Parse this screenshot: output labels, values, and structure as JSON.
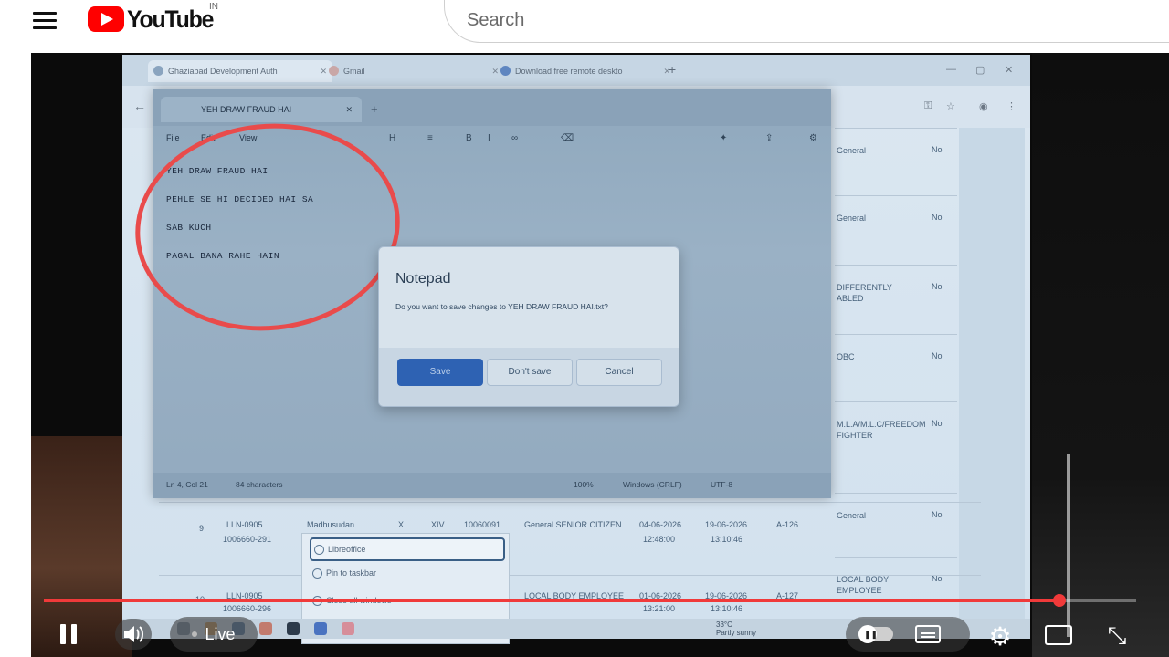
{
  "header": {
    "brand": "YouTube",
    "country": "IN",
    "search_placeholder": "Search"
  },
  "video": {
    "browser": {
      "tabs": [
        {
          "label": "Ghaziabad Development Auth"
        },
        {
          "label": "Gmail"
        },
        {
          "label": "Download free remote deskto"
        }
      ],
      "new_tab": "+"
    },
    "notepad": {
      "tab_title": "YEH DRAW FRAUD HAI",
      "menu": [
        "File",
        "Edit",
        "View"
      ],
      "lines": [
        "YEH DRAW FRAUD HAI",
        "PEHLE SE HI DECIDED HAI SA",
        "SAB KUCH",
        "PAGAL BANA RAHE HAIN"
      ],
      "status": [
        "Ln 4, Col 21",
        "84 characters",
        "100%",
        "Windows (CRLF)",
        "UTF-8"
      ]
    },
    "dialog": {
      "title": "Notepad",
      "message": "Do you want to save changes to YEH DRAW FRAUD HAI.txt?",
      "save": "Save",
      "dont_save": "Don't save",
      "cancel": "Cancel"
    },
    "background_table": {
      "rows": [
        {
          "category": "General",
          "flag": "No"
        },
        {
          "category": "General",
          "flag": "No"
        },
        {
          "category": "DIFFERENTLY ABLED",
          "flag": "No"
        },
        {
          "category": "OBC",
          "flag": "No"
        },
        {
          "category": "M.L.A/M.L.C/FREEDOM FIGHTER",
          "flag": "No"
        },
        {
          "category": "General",
          "flag": "No"
        },
        {
          "category": "LOCAL BODY EMPLOYEE",
          "flag": "No"
        }
      ]
    },
    "bottom_rows": [
      {
        "sno": "9",
        "id": "LLN-0905",
        "reg": "1006660-291",
        "name": "Madhusudan",
        "x1": "X",
        "x2": "XIV",
        "num": "10060091",
        "cat": "General SENIOR CITIZEN",
        "d1": "04-06-2026",
        "t1": "12:48:00",
        "d2": "19-06-2026",
        "t2": "13:10:46",
        "plot": "A-126"
      },
      {
        "sno": "10",
        "id": "LLN-0905",
        "reg": "1006660-296",
        "cat": "LOCAL BODY EMPLOYEE",
        "d1": "01-06-2026",
        "t1": "13:21:00",
        "d2": "19-06-2026",
        "t2": "13:10:46",
        "plot": "A-127"
      }
    ],
    "context_menu": {
      "items": [
        "Libreoffice",
        "Pin to taskbar",
        "Close all windows"
      ]
    },
    "taskbar": {
      "weather_temp": "33°C",
      "weather_desc": "Partly sunny"
    }
  },
  "player": {
    "live_label": "Live",
    "progress_fraction": 0.93,
    "accent": "#f03a3a"
  }
}
